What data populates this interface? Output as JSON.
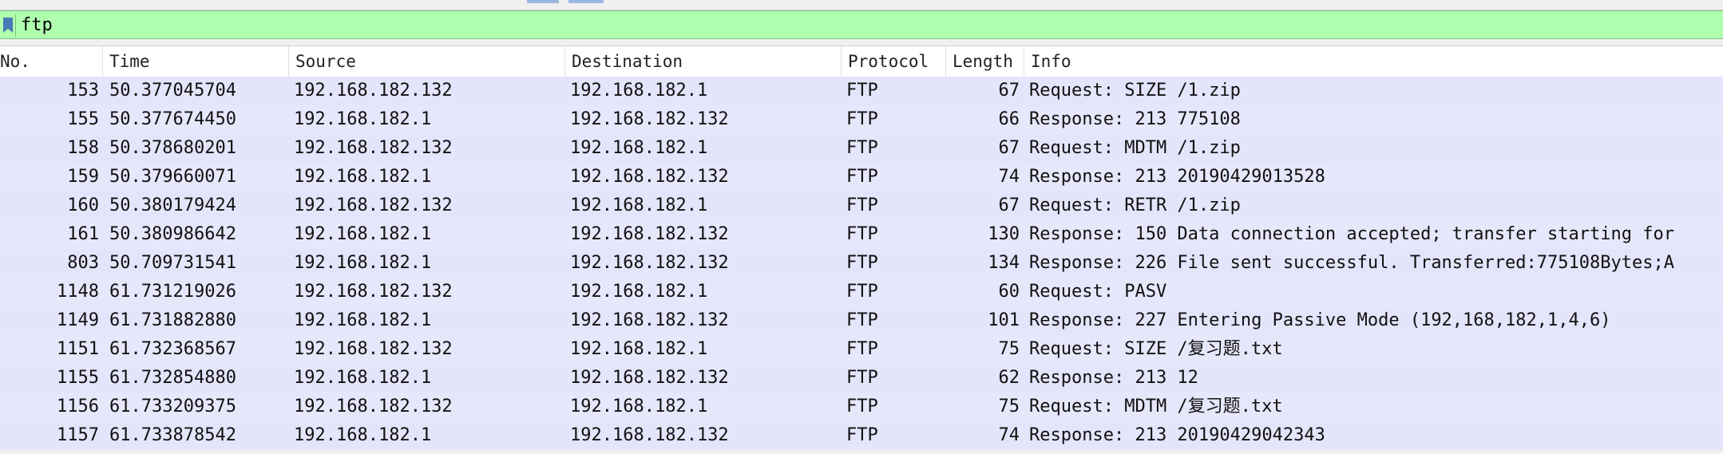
{
  "filter": {
    "value": "ftp",
    "bookmark_icon": "bookmark-icon"
  },
  "columns": [
    "No.",
    "Time",
    "Source",
    "Destination",
    "Protocol",
    "Length",
    "Info"
  ],
  "colors": {
    "filter_valid": "#afffaf",
    "row_bg": "#e4e4fb"
  },
  "rows": [
    {
      "no": "153",
      "time": "50.377045704",
      "src": "192.168.182.132",
      "dst": "192.168.182.1",
      "proto": "FTP",
      "len": "67",
      "info": "Request: SIZE /1.zip"
    },
    {
      "no": "155",
      "time": "50.377674450",
      "src": "192.168.182.1",
      "dst": "192.168.182.132",
      "proto": "FTP",
      "len": "66",
      "info": "Response: 213 775108"
    },
    {
      "no": "158",
      "time": "50.378680201",
      "src": "192.168.182.132",
      "dst": "192.168.182.1",
      "proto": "FTP",
      "len": "67",
      "info": "Request: MDTM /1.zip"
    },
    {
      "no": "159",
      "time": "50.379660071",
      "src": "192.168.182.1",
      "dst": "192.168.182.132",
      "proto": "FTP",
      "len": "74",
      "info": "Response: 213 20190429013528"
    },
    {
      "no": "160",
      "time": "50.380179424",
      "src": "192.168.182.132",
      "dst": "192.168.182.1",
      "proto": "FTP",
      "len": "67",
      "info": "Request: RETR /1.zip"
    },
    {
      "no": "161",
      "time": "50.380986642",
      "src": "192.168.182.1",
      "dst": "192.168.182.132",
      "proto": "FTP",
      "len": "130",
      "info": "Response: 150 Data connection accepted; transfer starting for"
    },
    {
      "no": "803",
      "time": "50.709731541",
      "src": "192.168.182.1",
      "dst": "192.168.182.132",
      "proto": "FTP",
      "len": "134",
      "info": "Response: 226 File sent successful. Transferred:775108Bytes;A"
    },
    {
      "no": "1148",
      "time": "61.731219026",
      "src": "192.168.182.132",
      "dst": "192.168.182.1",
      "proto": "FTP",
      "len": "60",
      "info": "Request: PASV"
    },
    {
      "no": "1149",
      "time": "61.731882880",
      "src": "192.168.182.1",
      "dst": "192.168.182.132",
      "proto": "FTP",
      "len": "101",
      "info": "Response: 227 Entering Passive Mode (192,168,182,1,4,6)"
    },
    {
      "no": "1151",
      "time": "61.732368567",
      "src": "192.168.182.132",
      "dst": "192.168.182.1",
      "proto": "FTP",
      "len": "75",
      "info": "Request: SIZE /复习题.txt"
    },
    {
      "no": "1155",
      "time": "61.732854880",
      "src": "192.168.182.1",
      "dst": "192.168.182.132",
      "proto": "FTP",
      "len": "62",
      "info": "Response: 213 12"
    },
    {
      "no": "1156",
      "time": "61.733209375",
      "src": "192.168.182.132",
      "dst": "192.168.182.1",
      "proto": "FTP",
      "len": "75",
      "info": "Request: MDTM /复习题.txt"
    },
    {
      "no": "1157",
      "time": "61.733878542",
      "src": "192.168.182.1",
      "dst": "192.168.182.132",
      "proto": "FTP",
      "len": "74",
      "info": "Response: 213 20190429042343"
    }
  ]
}
